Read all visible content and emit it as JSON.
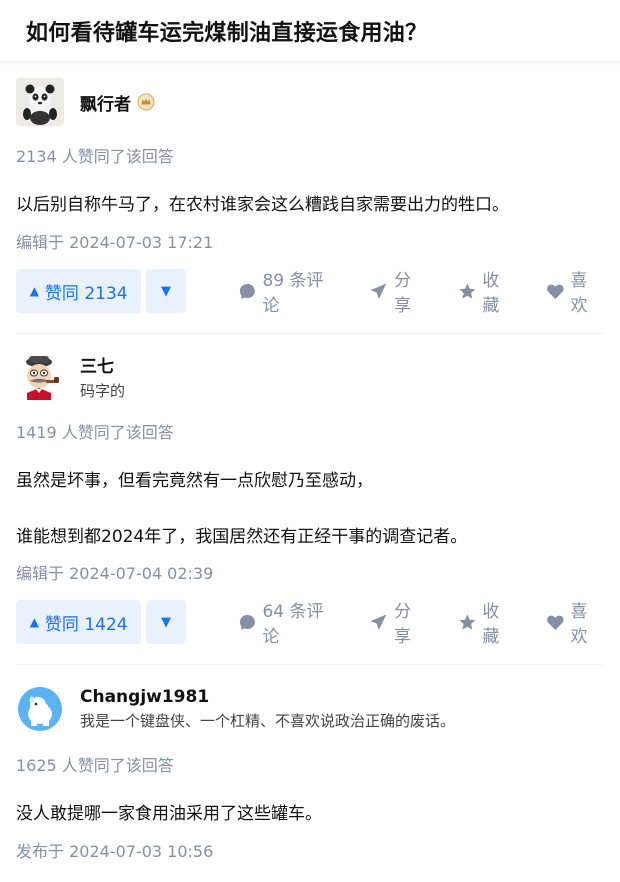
{
  "question": {
    "title": "如何看待罐车运完煤制油直接运食用油？"
  },
  "answers": [
    {
      "author": "飘行者",
      "bio": "",
      "votes_line": "2134 人赞同了该回答",
      "content": [
        "以后别自称牛马了，在农村谁家会这么糟践自家需要出力的牲口。"
      ],
      "time": "编辑于 2024-07-03 17:21",
      "vote_label": "赞同 2134",
      "comments": "89 条评论",
      "share": "分享",
      "collect": "收藏",
      "like": "喜欢"
    },
    {
      "author": "三七",
      "bio": "码字的",
      "votes_line": "1419 人赞同了该回答",
      "content": [
        "虽然是坏事，但看完竟然有一点欣慰乃至感动，",
        "谁能想到都2024年了，我国居然还有正经干事的调查记者。"
      ],
      "time": "编辑于 2024-07-04 02:39",
      "vote_label": "赞同 1424",
      "comments": "64 条评论",
      "share": "分享",
      "collect": "收藏",
      "like": "喜欢"
    },
    {
      "author": "Changjw1981",
      "bio": "我是一个键盘侠、一个杠精、不喜欢说政治正确的废话。",
      "votes_line": "1625 人赞同了该回答",
      "content": [
        "没人敢提哪一家食用油采用了这些罐车。"
      ],
      "time": "发布于 2024-07-03 10:56"
    }
  ],
  "colors": {
    "accent": "#1772f6",
    "accent_bg": "#e9f1fd",
    "muted": "#8590a6"
  }
}
